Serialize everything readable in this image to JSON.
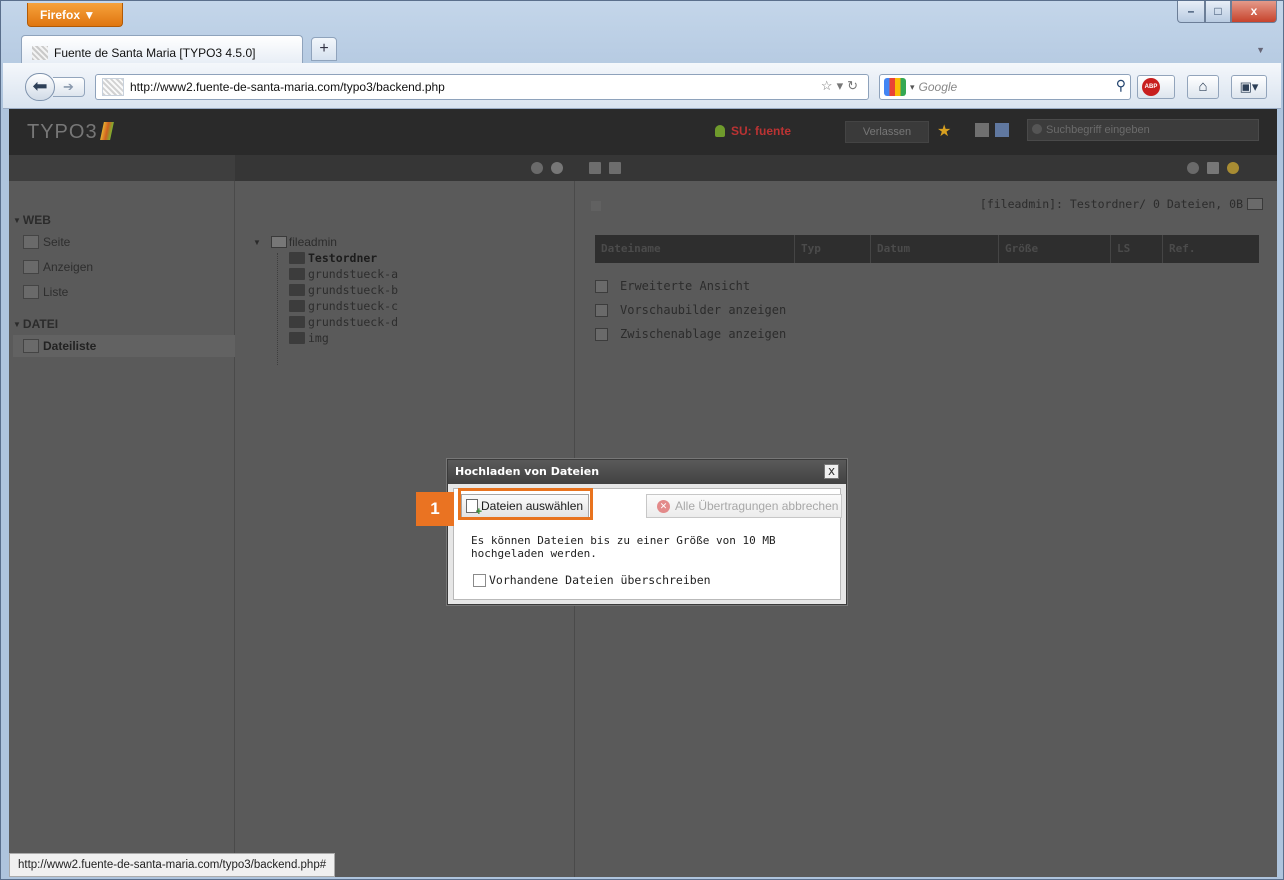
{
  "browser": {
    "menu_button": "Firefox ▼",
    "tab_title": "Fuente de Santa Maria [TYPO3 4.5.0]",
    "new_tab_glyph": "+",
    "url": "http://www2.fuente-de-santa-maria.com/typo3/backend.php",
    "search_placeholder": "Google",
    "search_engine_icon": "google-icon",
    "status_url": "http://www2.fuente-de-santa-maria.com/typo3/backend.php#",
    "window_buttons": {
      "minimize": "–",
      "maximize": "□",
      "close": "x"
    }
  },
  "typo3": {
    "logo": "TYPO3",
    "user_label": "SU: fuente",
    "logout_label": "Verlassen",
    "search_placeholder": "Suchbegriff eingeben",
    "modules": [
      {
        "group": "WEB",
        "items": [
          "Seite",
          "Anzeigen",
          "Liste"
        ]
      },
      {
        "group": "DATEI",
        "items": [
          "Dateiliste"
        ]
      }
    ],
    "active_module": "Dateiliste",
    "tree": {
      "root": "fileadmin",
      "folders": [
        "Testordner",
        "grundstueck-a",
        "grundstueck-b",
        "grundstueck-c",
        "grundstueck-d",
        "img"
      ],
      "selected": "Testordner"
    },
    "path_info": "[fileadmin]: Testordner/ 0 Dateien, 0B",
    "columns": [
      "Dateiname",
      "Typ",
      "Datum",
      "Größe",
      "LS",
      "Ref."
    ],
    "options": [
      "Erweiterte Ansicht",
      "Vorschaubilder anzeigen",
      "Zwischenablage anzeigen"
    ]
  },
  "dialog": {
    "title": "Hochladen von Dateien",
    "close_glyph": "x",
    "select_button": "Dateien auswählen",
    "abort_button": "Alle Übertragungen abbrechen",
    "info_line1": "Es können Dateien bis zu einer Größe von 10 MB",
    "info_line2": "hochgeladen werden.",
    "overwrite_label": "Vorhandene Dateien überschreiben"
  },
  "annotation": {
    "step": "1",
    "color": "#e8731e"
  }
}
